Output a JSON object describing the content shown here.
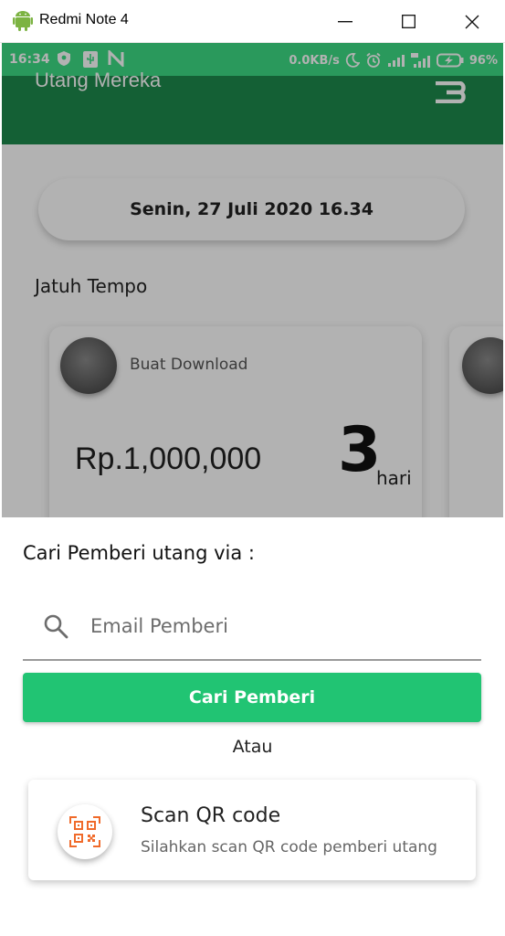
{
  "window": {
    "title": "Redmi Note 4"
  },
  "statusbar": {
    "time": "16:34",
    "network_speed": "0.0KB/s",
    "battery": "96%"
  },
  "app": {
    "title": "Utang Mereka",
    "date_label": "Senin, 27 Juli 2020 16.34",
    "section_label": "Jatuh Tempo",
    "cards": [
      {
        "name": "Buat Download",
        "amount": "Rp.1,000,000",
        "days": "3",
        "days_unit": "hari"
      }
    ]
  },
  "sheet": {
    "title": "Cari Pemberi utang via :",
    "search": {
      "placeholder": "Email Pemberi",
      "value": ""
    },
    "search_button": "Cari Pemberi",
    "or_label": "Atau",
    "qr": {
      "title": "Scan QR code",
      "subtitle": "Silahkan scan QR code pemberi utang"
    }
  },
  "colors": {
    "statusbar": "#3ddc84",
    "appbar": "#1e8a4c",
    "primary_button": "#21c473",
    "qr_icon": "#f06a2a"
  },
  "icons": {
    "window": [
      "android-icon",
      "minimize-icon",
      "maximize-icon",
      "close-icon"
    ],
    "statusbar": [
      "shield-icon",
      "usb-icon",
      "n-icon",
      "moon-icon",
      "alarm-icon",
      "signal-icon",
      "signal-4g-icon",
      "battery-icon"
    ],
    "sheet": [
      "search-icon",
      "qr-code-icon"
    ]
  }
}
